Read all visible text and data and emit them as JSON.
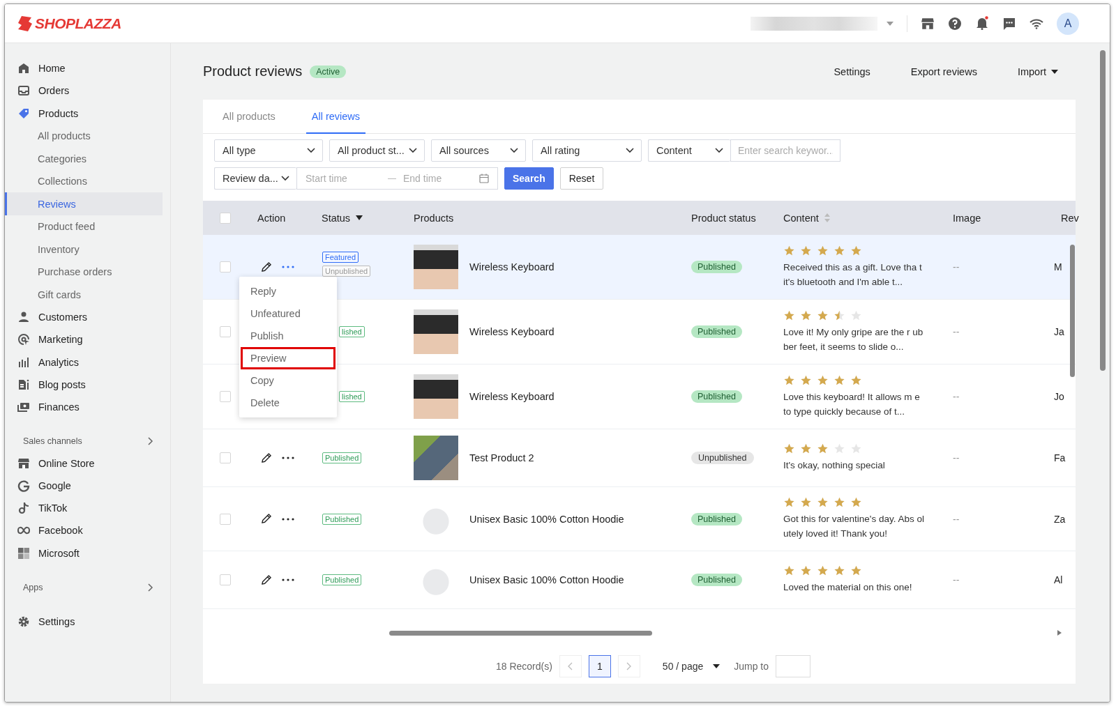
{
  "header": {
    "logo": "SHOPLAZZA",
    "unread_notifications": true,
    "avatar": "A"
  },
  "sidebar": {
    "groups": [
      {
        "items": [
          {
            "label": "Home",
            "selected": false
          },
          {
            "label": "Orders",
            "selected": false
          },
          {
            "label": "Products",
            "selected": false,
            "expanded": true,
            "children": [
              {
                "label": "All products",
                "selected": false
              },
              {
                "label": "Categories",
                "selected": false
              },
              {
                "label": "Collections",
                "selected": false
              },
              {
                "label": "Reviews",
                "selected": true
              },
              {
                "label": "Product feed",
                "selected": false
              },
              {
                "label": "Inventory",
                "selected": false
              },
              {
                "label": "Purchase orders",
                "selected": false
              },
              {
                "label": "Gift cards",
                "selected": false
              }
            ]
          },
          {
            "label": "Customers",
            "selected": false
          },
          {
            "label": "Marketing",
            "selected": false
          },
          {
            "label": "Analytics",
            "selected": false
          },
          {
            "label": "Blog posts",
            "selected": false
          },
          {
            "label": "Finances",
            "selected": false
          }
        ]
      },
      {
        "title": "Sales channels",
        "items": [
          {
            "label": "Online Store",
            "selected": false
          },
          {
            "label": "Google",
            "selected": false
          },
          {
            "label": "TikTok",
            "selected": false
          },
          {
            "label": "Facebook",
            "selected": false
          },
          {
            "label": "Microsoft",
            "selected": false
          }
        ]
      },
      {
        "title": "Apps"
      },
      {
        "items": [
          {
            "label": "Settings",
            "selected": false
          }
        ]
      }
    ]
  },
  "page": {
    "title": "Product reviews",
    "badge": "Active",
    "actions": [
      {
        "label": "Settings",
        "kind": "link"
      },
      {
        "label": "Export reviews",
        "kind": "link"
      },
      {
        "label": "Import",
        "kind": "dropdown"
      }
    ]
  },
  "tabs": [
    {
      "label": "All products",
      "selected": false
    },
    {
      "label": "All reviews",
      "selected": true
    }
  ],
  "filters": {
    "selects": [
      {
        "value": "All type"
      },
      {
        "value": "All product st..."
      },
      {
        "value": "All sources"
      },
      {
        "value": "All rating"
      }
    ],
    "search": {
      "field": "Content",
      "placeholder": "Enter search keywor..."
    },
    "date": {
      "field": "Review da...",
      "start_placeholder": "Start time",
      "end_placeholder": "End time"
    },
    "buttons": [
      {
        "label": "Search",
        "kind": "primary"
      },
      {
        "label": "Reset",
        "kind": "default"
      }
    ]
  },
  "table": {
    "columns": [
      {
        "kind": "checkbox",
        "checked": false
      },
      {
        "kind": "text",
        "label": "Action"
      },
      {
        "kind": "filter",
        "label": "Status"
      },
      {
        "kind": "text",
        "label": "Products"
      },
      {
        "kind": "text",
        "label": "Product status"
      },
      {
        "kind": "sort",
        "label": "Content"
      },
      {
        "kind": "text",
        "label": "Image"
      },
      {
        "kind": "text",
        "label": "Rev"
      }
    ],
    "rows": [
      {
        "selected": true,
        "checked": false,
        "menu_open": true,
        "tags": [
          {
            "label": "Featured",
            "kind": "featured"
          },
          {
            "label": "Unpublished",
            "kind": "unpublished"
          }
        ],
        "product": "Wireless Keyboard",
        "product_status": {
          "label": "Published",
          "kind": "published"
        },
        "stars": 5,
        "content": "Received this as a gift. Love tha t it's bluetooth and I'm able t...",
        "image": "--",
        "reviewer": "M"
      },
      {
        "selected": false,
        "checked": false,
        "menu_open": false,
        "tags": [
          {
            "label": "lished",
            "kind": "published"
          }
        ],
        "product": "Wireless Keyboard",
        "product_status": {
          "label": "Published",
          "kind": "published"
        },
        "stars": 3.5,
        "content": "Love it! My only gripe are the r ubber feet, it seems to slide o...",
        "image": "--",
        "reviewer": "Ja"
      },
      {
        "selected": false,
        "checked": false,
        "menu_open": false,
        "tags": [
          {
            "label": "lished",
            "kind": "published"
          }
        ],
        "product": "Wireless Keyboard",
        "product_status": {
          "label": "Published",
          "kind": "published"
        },
        "stars": 5,
        "content": "Love this keyboard! It allows m e to type quickly because of t...",
        "image": "--",
        "reviewer": "Jo"
      },
      {
        "selected": false,
        "checked": false,
        "menu_open": false,
        "tags": [
          {
            "label": "Published",
            "kind": "published"
          }
        ],
        "product": "Test Product 2",
        "product_status": {
          "label": "Unpublished",
          "kind": "unpublished"
        },
        "stars": 3,
        "content": "It's okay, nothing special",
        "image": "--",
        "reviewer": "Fa"
      },
      {
        "selected": false,
        "checked": false,
        "menu_open": false,
        "tags": [
          {
            "label": "Published",
            "kind": "published"
          }
        ],
        "product": "Unisex Basic 100% Cotton Hoodie",
        "product_status": {
          "label": "Published",
          "kind": "published"
        },
        "stars": 5,
        "content": "Got this for valentine's day. Abs olutely loved it! Thank you!",
        "image": "--",
        "reviewer": "Za"
      },
      {
        "selected": false,
        "checked": false,
        "menu_open": false,
        "tags": [
          {
            "label": "Published",
            "kind": "published"
          }
        ],
        "product": "Unisex Basic 100% Cotton Hoodie",
        "product_status": {
          "label": "Published",
          "kind": "published"
        },
        "stars": 5,
        "content": "Loved the material on this one!",
        "image": "--",
        "reviewer": "Al"
      }
    ]
  },
  "action_menu": [
    {
      "label": "Reply",
      "highlighted": false
    },
    {
      "label": "Unfeatured",
      "highlighted": false
    },
    {
      "label": "Publish",
      "highlighted": false
    },
    {
      "label": "Preview",
      "highlighted": true
    },
    {
      "label": "Copy",
      "highlighted": false
    },
    {
      "label": "Delete",
      "highlighted": false
    }
  ],
  "pagination": {
    "total": "18 Record(s)",
    "pages": [
      {
        "label": "1",
        "selected": true
      }
    ],
    "page_size": "50 / page",
    "jump_label": "Jump to"
  }
}
